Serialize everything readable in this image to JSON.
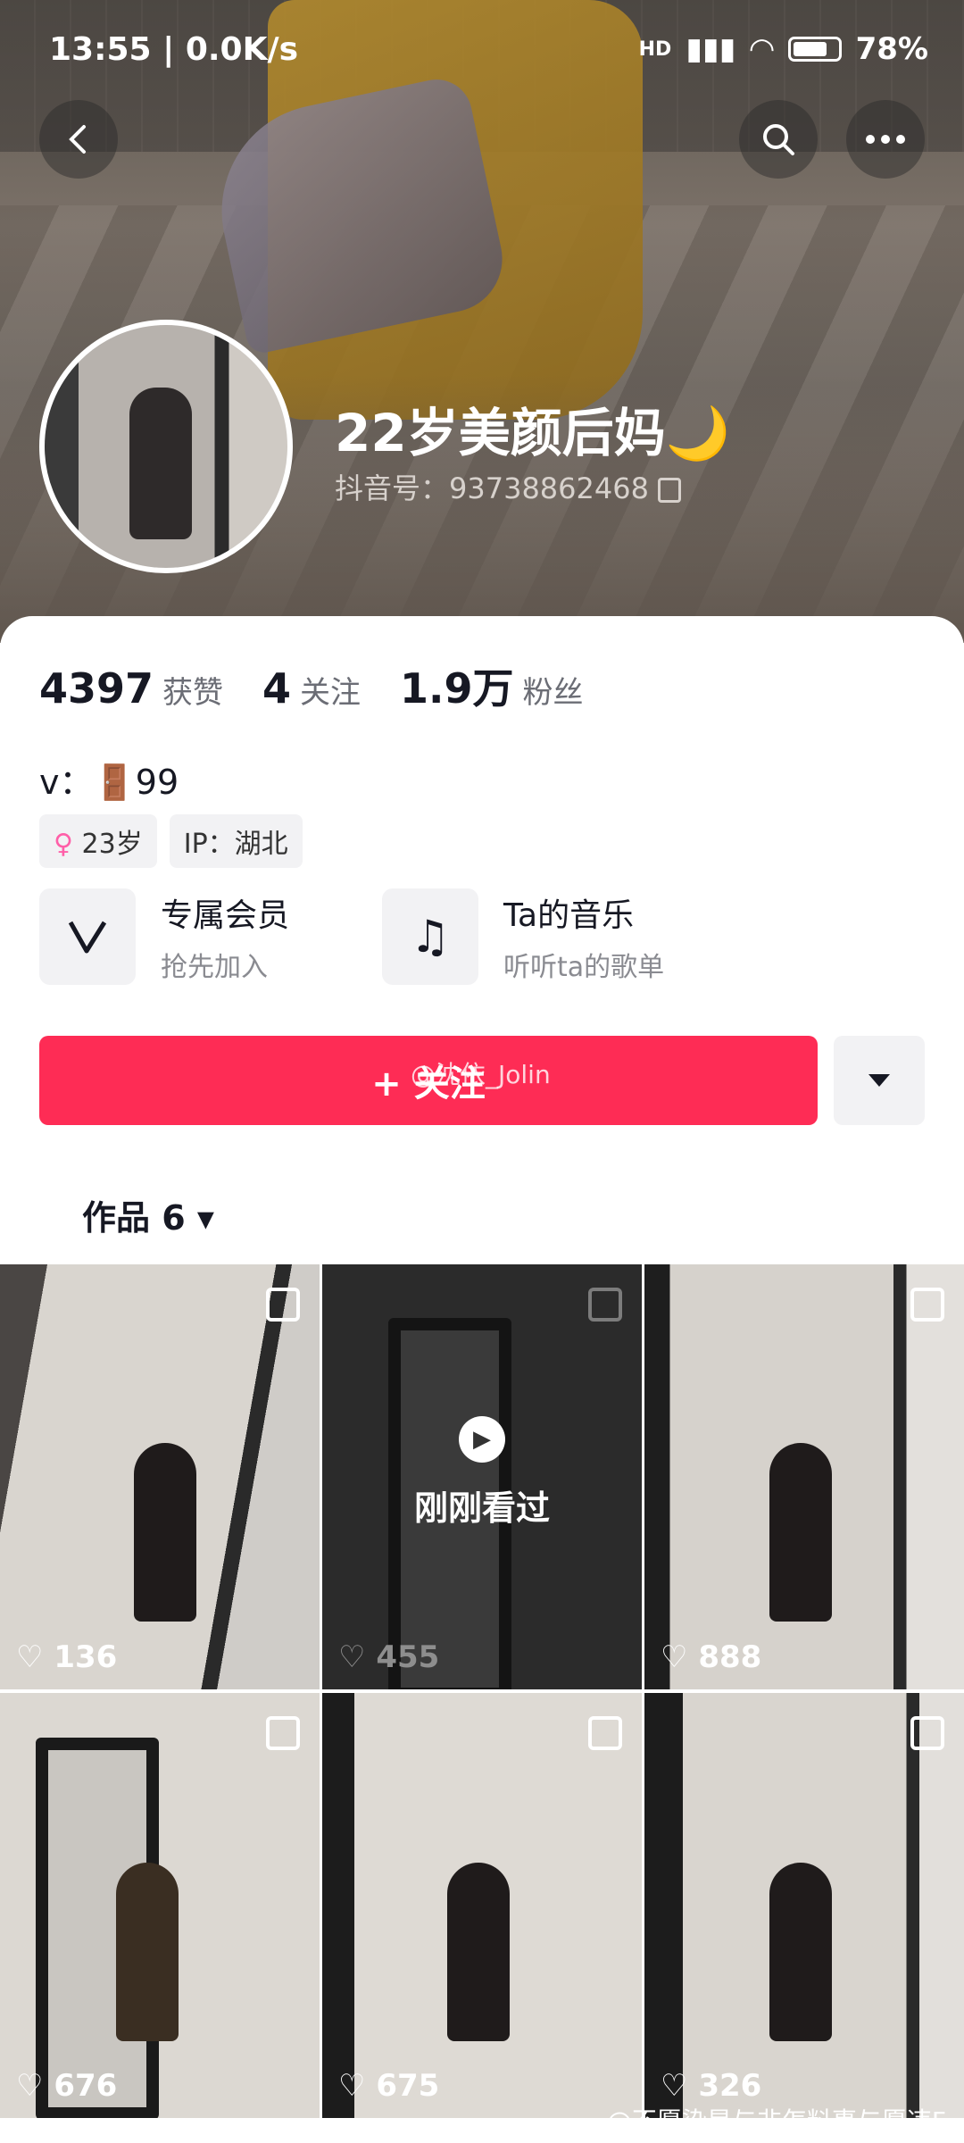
{
  "status": {
    "time": "13:55",
    "speed": "0.0K/s",
    "network": "HD",
    "battery": "78%"
  },
  "profile": {
    "name": "22岁美颜后妈🌙",
    "douyin_id": "抖音号：93738862468",
    "stats": [
      {
        "num": "4397",
        "label": "获赞"
      },
      {
        "num": "4",
        "label": "关注"
      },
      {
        "num": "1.9万",
        "label": "粉丝"
      }
    ],
    "bio": "v：🚪99",
    "tags": [
      {
        "icon": "♀",
        "text": "23岁"
      },
      {
        "icon": "",
        "text": "IP：湖北"
      }
    ]
  },
  "features": [
    {
      "title": "专属会员",
      "sub": "抢先加入",
      "icon": "vip-icon"
    },
    {
      "title": "Ta的音乐",
      "sub": "听听ta的歌单",
      "icon": "music-icon"
    }
  ],
  "follow_label": "+ 关注",
  "overlay_watermark": "@沈依_Jolin",
  "tab_label": "作品 6 ▾",
  "videos": [
    {
      "likes": "136"
    },
    {
      "likes": "455",
      "seen_label": "刚刚看过"
    },
    {
      "likes": "888"
    },
    {
      "likes": "676"
    },
    {
      "likes": "675"
    },
    {
      "likes": "326"
    }
  ],
  "credit": "@不愿染是与非怎料事与愿违F"
}
